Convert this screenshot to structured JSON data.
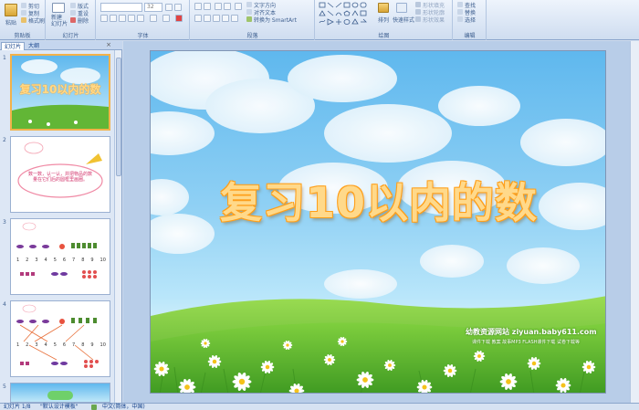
{
  "ribbon": {
    "clipboard": {
      "paste_label": "粘贴",
      "cut_label": "剪切",
      "copy_label": "复制",
      "format_painter_label": "格式刷",
      "group_label": "剪贴板"
    },
    "slides": {
      "new_slide_label": "新建\n幻灯片",
      "layout_label": "版式",
      "reset_label": "重设",
      "delete_label": "删除",
      "group_label": "幻灯片"
    },
    "font": {
      "font_name": "",
      "font_size": "32",
      "group_label": "字体"
    },
    "paragraph": {
      "text_direction_label": "文字方向",
      "align_text_label": "对齐文本",
      "smartart_label": "转换为 SmartArt",
      "group_label": "段落"
    },
    "drawing": {
      "arrange_label": "排列",
      "quick_styles_label": "快速样式",
      "shape_fill_label": "形状填充",
      "shape_outline_label": "形状轮廓",
      "shape_effects_label": "形状效果",
      "group_label": "绘图"
    },
    "editing": {
      "find_label": "查找",
      "replace_label": "替换",
      "select_label": "选择",
      "group_label": "编辑"
    }
  },
  "left_pane": {
    "tabs": [
      "幻灯片",
      "大纲"
    ],
    "close_glyph": "×",
    "slide_numbers": [
      "1",
      "2",
      "3",
      "4",
      "5"
    ],
    "thumb1_title": "复习10以内的数",
    "thumb2_text": "数一数，认一认，并把物品的数量在它们后的圆框里画圈。",
    "thumb_numbers": [
      "1",
      "2",
      "3",
      "4",
      "5",
      "6",
      "7",
      "8",
      "9",
      "10"
    ]
  },
  "slide": {
    "title": "复习10以内的数",
    "watermark_site": "幼教资源网站  ziyuan.baby611.com",
    "watermark_links": "课件下载   教案   故事MP3   FLASH课件下载   试卷下载等"
  },
  "status_bar": {
    "slide_indicator": "幻灯片 1/8",
    "theme": "\"默认设计模板\"",
    "language": "中文(简体，中国)"
  },
  "colors": {
    "title_fill": "#ffd98a",
    "title_stroke": "#ff9f1a",
    "ribbon_text": "#15428b"
  }
}
